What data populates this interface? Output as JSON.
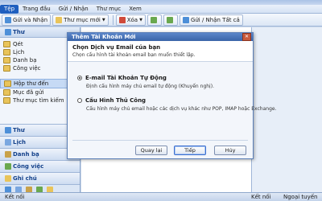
{
  "menubar": {
    "items": [
      "Tệp",
      "Trang đầu",
      "Gửi / Nhận",
      "Thư mục",
      "Xem"
    ],
    "active_index": 0
  },
  "toolbar": {
    "send_receive": "Gửi và Nhận",
    "new_folder": "Thư mục mới",
    "delete": "Xóa",
    "send_receive_all": "Gửi / Nhận Tất cả"
  },
  "navpane": {
    "header": "Thư",
    "items": [
      {
        "label": "Qét"
      },
      {
        "label": "Lịch"
      },
      {
        "label": "Danh bạ"
      },
      {
        "label": "Công việc"
      }
    ],
    "items2": [
      {
        "label": "Hộp thư đến",
        "selected": true
      },
      {
        "label": "Mục đã gửi"
      },
      {
        "label": "Thư mục tìm kiếm"
      }
    ],
    "sections": [
      "Thư",
      "Lịch",
      "Danh bạ",
      "Công việc",
      "Ghi chú"
    ]
  },
  "statusbar": {
    "left": "Kết nối",
    "mid": "Kết nối",
    "right": "Ngoại tuyến"
  },
  "dialog": {
    "title": "Thêm Tài Khoản Mới",
    "header_title": "Chọn Dịch vụ Email của bạn",
    "header_subtitle": "Chọn cấu hình tài khoản email bạn muốn thiết lập.",
    "options": [
      {
        "label": "E-mail Tài Khoản Tự Động",
        "desc": "Định cấu hình máy chủ email tự động (Khuyến nghị).",
        "checked": true
      },
      {
        "label": "Cấu Hình Thủ Công",
        "desc": "Cấu hình máy chủ email hoặc các dịch vụ khác như POP, IMAP hoặc Exchange.",
        "checked": false
      }
    ],
    "buttons": {
      "back": "Quay lại",
      "next": "Tiếp",
      "cancel": "Hủy"
    }
  },
  "colors": {
    "accent": "#1f5fbf",
    "dialog_title": "#3a64a8"
  }
}
